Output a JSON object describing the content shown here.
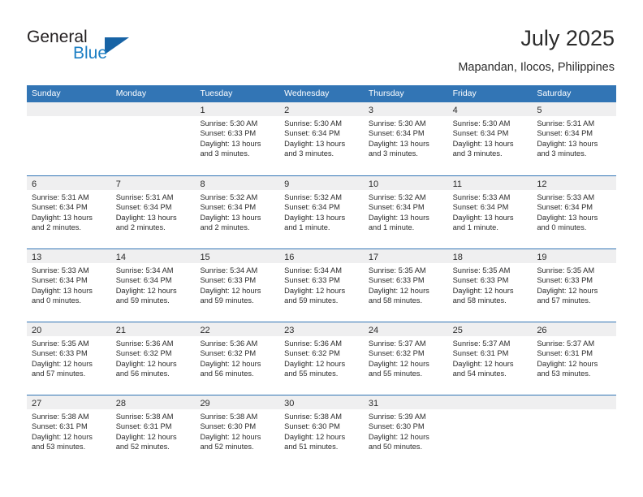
{
  "brand": {
    "line1": "General",
    "line2": "Blue",
    "triangle_icon": "brand-triangle-icon",
    "colors": {
      "general": "#231f20",
      "blue": "#1d7fc4",
      "triangle": "#1763a5"
    }
  },
  "header": {
    "title": "July 2025",
    "subtitle": "Mapandan, Ilocos, Philippines"
  },
  "theme": {
    "header_bg": "#3275b5",
    "day_band_bg": "#efeff0",
    "text": "#2b2b2b",
    "page_bg": "#ffffff"
  },
  "calendar": {
    "weekdays": [
      "Sunday",
      "Monday",
      "Tuesday",
      "Wednesday",
      "Thursday",
      "Friday",
      "Saturday"
    ],
    "weeks": [
      [
        {
          "day": "",
          "lines": []
        },
        {
          "day": "",
          "lines": []
        },
        {
          "day": "1",
          "lines": [
            "Sunrise: 5:30 AM",
            "Sunset: 6:33 PM",
            "Daylight: 13 hours",
            "and 3 minutes."
          ]
        },
        {
          "day": "2",
          "lines": [
            "Sunrise: 5:30 AM",
            "Sunset: 6:34 PM",
            "Daylight: 13 hours",
            "and 3 minutes."
          ]
        },
        {
          "day": "3",
          "lines": [
            "Sunrise: 5:30 AM",
            "Sunset: 6:34 PM",
            "Daylight: 13 hours",
            "and 3 minutes."
          ]
        },
        {
          "day": "4",
          "lines": [
            "Sunrise: 5:30 AM",
            "Sunset: 6:34 PM",
            "Daylight: 13 hours",
            "and 3 minutes."
          ]
        },
        {
          "day": "5",
          "lines": [
            "Sunrise: 5:31 AM",
            "Sunset: 6:34 PM",
            "Daylight: 13 hours",
            "and 3 minutes."
          ]
        }
      ],
      [
        {
          "day": "6",
          "lines": [
            "Sunrise: 5:31 AM",
            "Sunset: 6:34 PM",
            "Daylight: 13 hours",
            "and 2 minutes."
          ]
        },
        {
          "day": "7",
          "lines": [
            "Sunrise: 5:31 AM",
            "Sunset: 6:34 PM",
            "Daylight: 13 hours",
            "and 2 minutes."
          ]
        },
        {
          "day": "8",
          "lines": [
            "Sunrise: 5:32 AM",
            "Sunset: 6:34 PM",
            "Daylight: 13 hours",
            "and 2 minutes."
          ]
        },
        {
          "day": "9",
          "lines": [
            "Sunrise: 5:32 AM",
            "Sunset: 6:34 PM",
            "Daylight: 13 hours",
            "and 1 minute."
          ]
        },
        {
          "day": "10",
          "lines": [
            "Sunrise: 5:32 AM",
            "Sunset: 6:34 PM",
            "Daylight: 13 hours",
            "and 1 minute."
          ]
        },
        {
          "day": "11",
          "lines": [
            "Sunrise: 5:33 AM",
            "Sunset: 6:34 PM",
            "Daylight: 13 hours",
            "and 1 minute."
          ]
        },
        {
          "day": "12",
          "lines": [
            "Sunrise: 5:33 AM",
            "Sunset: 6:34 PM",
            "Daylight: 13 hours",
            "and 0 minutes."
          ]
        }
      ],
      [
        {
          "day": "13",
          "lines": [
            "Sunrise: 5:33 AM",
            "Sunset: 6:34 PM",
            "Daylight: 13 hours",
            "and 0 minutes."
          ]
        },
        {
          "day": "14",
          "lines": [
            "Sunrise: 5:34 AM",
            "Sunset: 6:34 PM",
            "Daylight: 12 hours",
            "and 59 minutes."
          ]
        },
        {
          "day": "15",
          "lines": [
            "Sunrise: 5:34 AM",
            "Sunset: 6:33 PM",
            "Daylight: 12 hours",
            "and 59 minutes."
          ]
        },
        {
          "day": "16",
          "lines": [
            "Sunrise: 5:34 AM",
            "Sunset: 6:33 PM",
            "Daylight: 12 hours",
            "and 59 minutes."
          ]
        },
        {
          "day": "17",
          "lines": [
            "Sunrise: 5:35 AM",
            "Sunset: 6:33 PM",
            "Daylight: 12 hours",
            "and 58 minutes."
          ]
        },
        {
          "day": "18",
          "lines": [
            "Sunrise: 5:35 AM",
            "Sunset: 6:33 PM",
            "Daylight: 12 hours",
            "and 58 minutes."
          ]
        },
        {
          "day": "19",
          "lines": [
            "Sunrise: 5:35 AM",
            "Sunset: 6:33 PM",
            "Daylight: 12 hours",
            "and 57 minutes."
          ]
        }
      ],
      [
        {
          "day": "20",
          "lines": [
            "Sunrise: 5:35 AM",
            "Sunset: 6:33 PM",
            "Daylight: 12 hours",
            "and 57 minutes."
          ]
        },
        {
          "day": "21",
          "lines": [
            "Sunrise: 5:36 AM",
            "Sunset: 6:32 PM",
            "Daylight: 12 hours",
            "and 56 minutes."
          ]
        },
        {
          "day": "22",
          "lines": [
            "Sunrise: 5:36 AM",
            "Sunset: 6:32 PM",
            "Daylight: 12 hours",
            "and 56 minutes."
          ]
        },
        {
          "day": "23",
          "lines": [
            "Sunrise: 5:36 AM",
            "Sunset: 6:32 PM",
            "Daylight: 12 hours",
            "and 55 minutes."
          ]
        },
        {
          "day": "24",
          "lines": [
            "Sunrise: 5:37 AM",
            "Sunset: 6:32 PM",
            "Daylight: 12 hours",
            "and 55 minutes."
          ]
        },
        {
          "day": "25",
          "lines": [
            "Sunrise: 5:37 AM",
            "Sunset: 6:31 PM",
            "Daylight: 12 hours",
            "and 54 minutes."
          ]
        },
        {
          "day": "26",
          "lines": [
            "Sunrise: 5:37 AM",
            "Sunset: 6:31 PM",
            "Daylight: 12 hours",
            "and 53 minutes."
          ]
        }
      ],
      [
        {
          "day": "27",
          "lines": [
            "Sunrise: 5:38 AM",
            "Sunset: 6:31 PM",
            "Daylight: 12 hours",
            "and 53 minutes."
          ]
        },
        {
          "day": "28",
          "lines": [
            "Sunrise: 5:38 AM",
            "Sunset: 6:31 PM",
            "Daylight: 12 hours",
            "and 52 minutes."
          ]
        },
        {
          "day": "29",
          "lines": [
            "Sunrise: 5:38 AM",
            "Sunset: 6:30 PM",
            "Daylight: 12 hours",
            "and 52 minutes."
          ]
        },
        {
          "day": "30",
          "lines": [
            "Sunrise: 5:38 AM",
            "Sunset: 6:30 PM",
            "Daylight: 12 hours",
            "and 51 minutes."
          ]
        },
        {
          "day": "31",
          "lines": [
            "Sunrise: 5:39 AM",
            "Sunset: 6:30 PM",
            "Daylight: 12 hours",
            "and 50 minutes."
          ]
        },
        {
          "day": "",
          "lines": []
        },
        {
          "day": "",
          "lines": []
        }
      ]
    ]
  }
}
